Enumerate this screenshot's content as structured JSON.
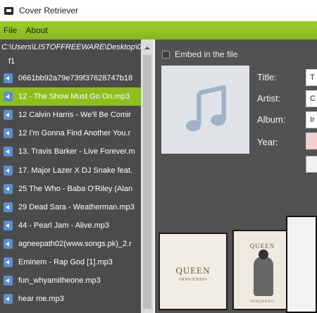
{
  "app": {
    "title": "Cover Retriever"
  },
  "menu": {
    "items": [
      "File",
      "About"
    ]
  },
  "file_list": {
    "path": "C:\\Users\\LISTOFFREEWARE\\Desktop\\0",
    "folder": "f1",
    "files": [
      "0661bb92a79e739f37628747b18",
      "12 - The Show Must Go On.mp3",
      "12 Calvin Harris - We'll Be Comir",
      "12 I'm Gonna Find Another You.r",
      "13. Travis Barker - Live Forever.m",
      "17. Major Lazer X DJ Snake feat.",
      "25 The Who - Baba O'Riley (Alan",
      "29 Dead Sara - Weatherman.mp3",
      "44 - Pearl Jam - Alive.mp3",
      "agneepath02(www.songs.pk)_2.r",
      "Eminem - Rap God [1].mp3",
      "fun_whyamitheone.mp3",
      "hear me.mp3"
    ],
    "selected_index": 1
  },
  "details": {
    "embed_label": "Embed in the file",
    "embed_checked": false,
    "title_label": "Title:",
    "artist_label": "Artist:",
    "album_label": "Album:",
    "year_label": "Year:",
    "title_value": "T",
    "artist_value": "C",
    "album_value": "Ir",
    "year_value": ""
  },
  "albums": {
    "album1_title": "QUEEN",
    "album1_subtitle": "INNUENDO",
    "album2_title": "QUEEN",
    "album2_subtitle": "INNUENDO"
  },
  "colors": {
    "accent": "#8dbe1e",
    "menubar": "#9fcd2f",
    "left_panel": "#4b4b4b",
    "right_panel": "#525252"
  }
}
